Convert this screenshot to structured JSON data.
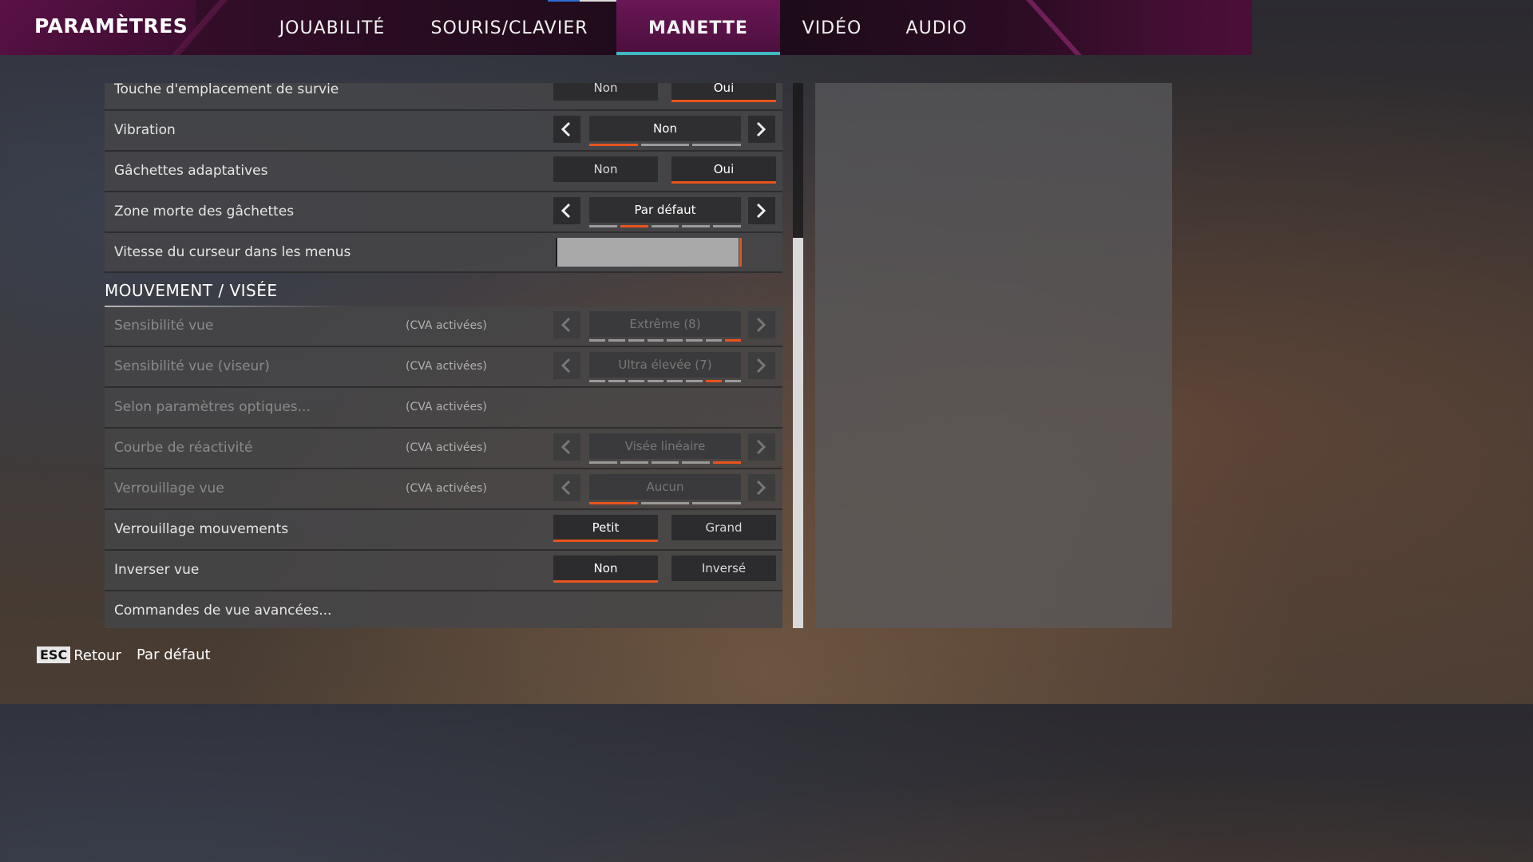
{
  "header": {
    "title": "PARAMÈTRES",
    "tabs": [
      {
        "label": "JOUABILITÉ"
      },
      {
        "label": "SOURIS/CLAVIER"
      },
      {
        "label": "MANETTE"
      },
      {
        "label": "VIDÉO"
      },
      {
        "label": "AUDIO"
      }
    ],
    "active_tab": "MANETTE",
    "accent_color": "#3fb8c4"
  },
  "settings": {
    "survival_key": {
      "label": "Touche d'emplacement de survie",
      "options": [
        "Non",
        "Oui"
      ],
      "selected": "Oui"
    },
    "vibration": {
      "label": "Vibration",
      "value": "Non",
      "steps": 3,
      "step_index": 0
    },
    "adaptive_triggers": {
      "label": "Gâchettes adaptatives",
      "options": [
        "Non",
        "Oui"
      ],
      "selected": "Oui"
    },
    "trigger_deadzone": {
      "label": "Zone morte des gâchettes",
      "value": "Par défaut",
      "steps": 5,
      "step_index": 1
    },
    "menu_cursor_speed": {
      "label": "Vitesse du curseur dans les menus",
      "level": 1.0
    }
  },
  "movement": {
    "section_title": "MOUVEMENT / VISÉE",
    "look_sensitivity": {
      "label": "Sensibilité vue",
      "note": "(CVA activées)",
      "value": "Extrême (8)",
      "steps": 8,
      "step_index": 7
    },
    "ads_sensitivity": {
      "label": "Sensibilité vue (viseur)",
      "note": "(CVA activées)",
      "value": "Ultra élevée (7)",
      "steps": 8,
      "step_index": 6
    },
    "optics": {
      "label": "Selon paramètres optiques...",
      "note": "(CVA activées)"
    },
    "response_curve": {
      "label": "Courbe de réactivité",
      "note": "(CVA activées)",
      "value": "Visée linéaire",
      "steps": 5,
      "step_index": 4
    },
    "view_deadzone": {
      "label": "Verrouillage vue",
      "note": "(CVA activées)",
      "value": "Aucun",
      "steps": 3,
      "step_index": 0
    },
    "move_deadzone": {
      "label": "Verrouillage mouvements",
      "options": [
        "Petit",
        "Grand"
      ],
      "selected": "Petit"
    },
    "invert_look": {
      "label": "Inverser vue",
      "options": [
        "Non",
        "Inversé"
      ],
      "selected": "Non"
    },
    "advanced_look": {
      "label": "Commandes de vue avancées..."
    }
  },
  "footer": {
    "esc_key": "ESC",
    "back_label": "Retour",
    "default_label": "Par défaut"
  },
  "colors": {
    "selection_accent": "#e8541e"
  }
}
